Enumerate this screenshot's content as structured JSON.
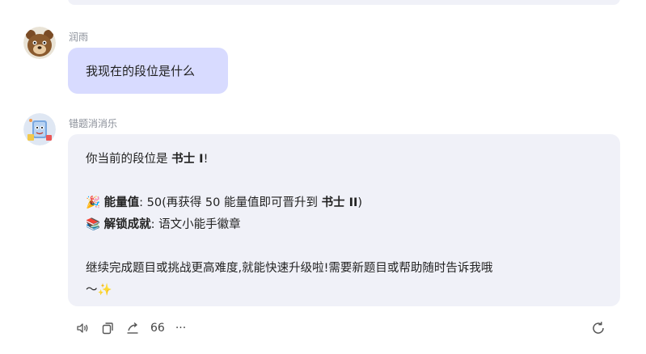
{
  "messages": {
    "user": {
      "name": "润雨",
      "text": "我现在的段位是什么"
    },
    "bot": {
      "name": "错题消消乐",
      "line1_prefix": "你当前的段位是 ",
      "line1_rank": "书士 I",
      "line1_suffix": "!",
      "energy_emoji": "🎉",
      "energy_label": "能量值",
      "energy_sep": ": ",
      "energy_text": "50(再获得 50 能量值即可晋升到 ",
      "energy_next_rank": "书士 II",
      "energy_close": ")",
      "unlock_emoji": "📚",
      "unlock_label": "解锁成就",
      "unlock_sep": ": ",
      "unlock_text": "语文小能手徽章",
      "closing_line": "继续完成题目或挑战更高难度,就能快速升级啦!需要新题目或帮助随时告诉我哦",
      "closing_tail": "〜",
      "sparkle_emoji": "✨"
    }
  },
  "toolbar": {
    "speaker_icon": "speaker-icon",
    "copy_icon": "copy-icon",
    "share_icon": "share-icon",
    "quote_glyph": "66",
    "more_glyph": "···",
    "refresh_icon": "refresh-icon"
  },
  "colors": {
    "user_bubble": "#d8dbff",
    "bot_bubble": "#f0f1f8",
    "name_text": "#8a8f99"
  }
}
